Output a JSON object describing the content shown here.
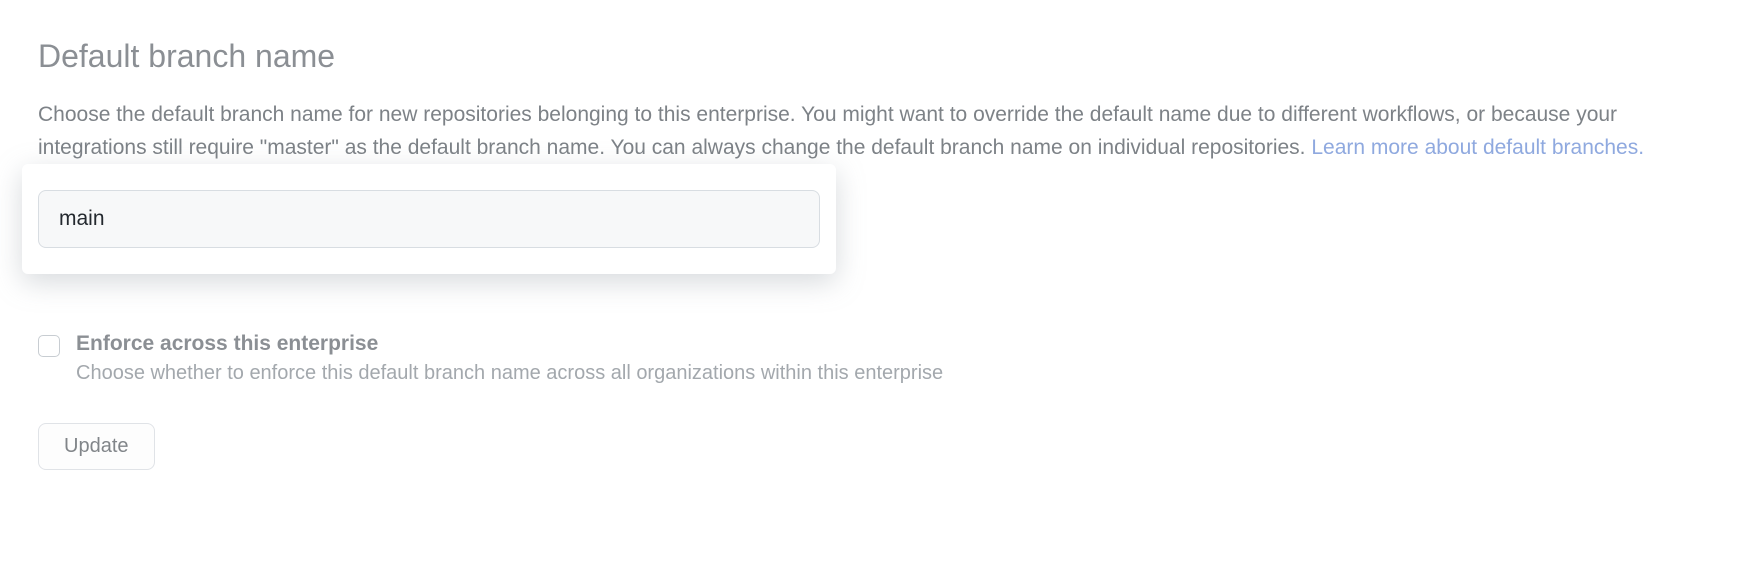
{
  "section": {
    "title": "Default branch name",
    "description": "Choose the default branch name for new repositories belonging to this enterprise. You might want to override the default name due to different workflows, or because your integrations still require \"master\" as the default branch name. You can always change the default branch name on individual repositories. ",
    "learn_more": "Learn more about default branches."
  },
  "input": {
    "value": "main"
  },
  "enforce": {
    "label": "Enforce across this enterprise",
    "description": "Choose whether to enforce this default branch name across all organizations within this enterprise"
  },
  "actions": {
    "update": "Update"
  }
}
